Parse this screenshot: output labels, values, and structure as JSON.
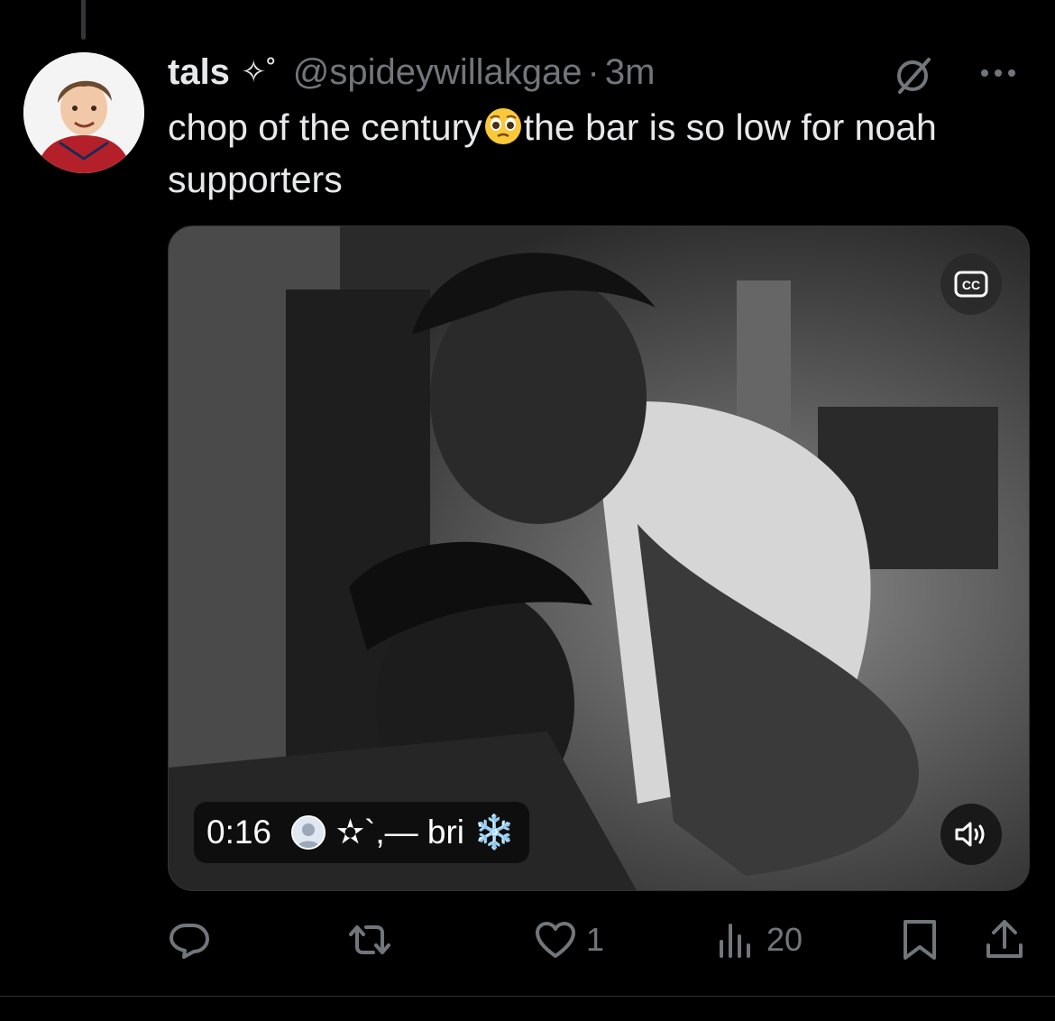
{
  "tweet": {
    "display_name": "tals",
    "name_decoration": "✧˚",
    "handle": "@spideywillakgae",
    "separator": "·",
    "timestamp": "3m",
    "text_part1": "chop of the century",
    "text_part2": "the bar is so low for noah supporters",
    "emoji_icon": "pleading-face-emoji"
  },
  "media": {
    "duration": "0:16",
    "credit": "✫`,— bri ❄️",
    "cc_label": "CC",
    "cc_icon": "closed-captions-icon",
    "volume_icon": "volume-icon"
  },
  "actions": {
    "reply_icon": "reply-icon",
    "retweet_icon": "retweet-icon",
    "like_icon": "heart-icon",
    "like_count": "1",
    "views_icon": "views-icon",
    "view_count": "20",
    "bookmark_icon": "bookmark-icon",
    "share_icon": "share-icon"
  },
  "colors": {
    "background": "#000000",
    "text_primary": "#e7e9ea",
    "text_secondary": "#71767b",
    "border": "#2f3336"
  }
}
